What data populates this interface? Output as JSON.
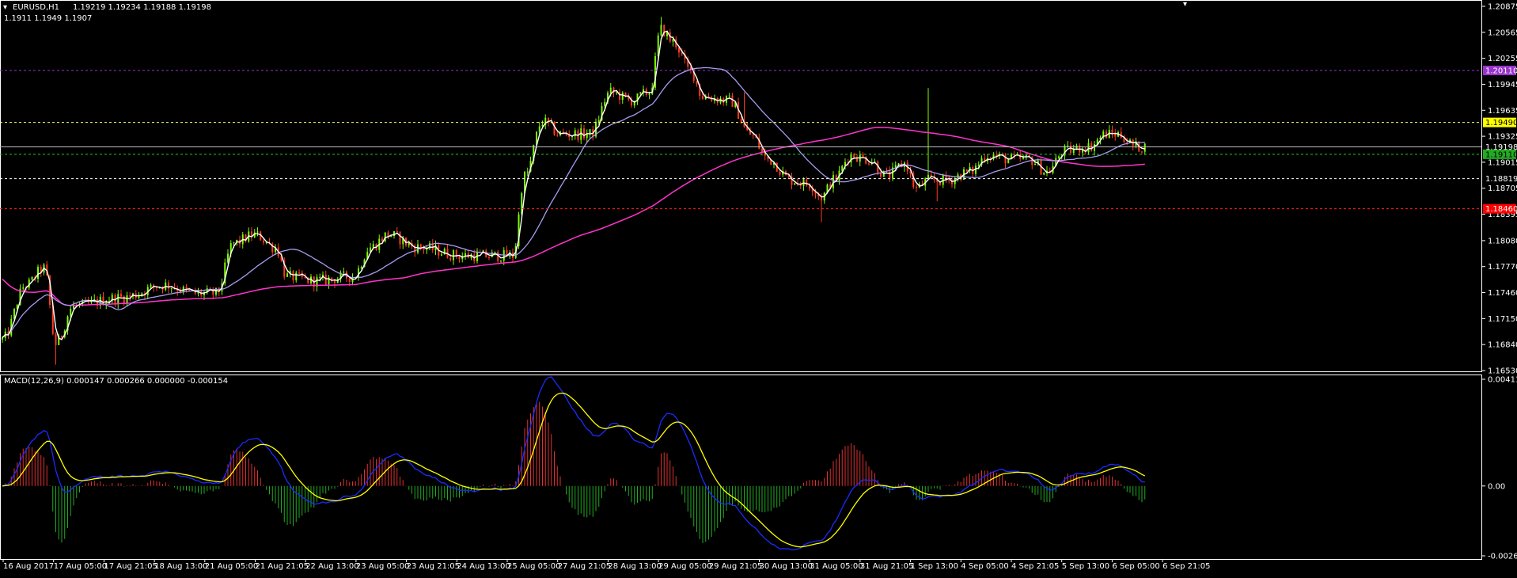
{
  "colors": {
    "background": "#000000",
    "frame": "#ffffff",
    "bull": "#7cfc00",
    "bear": "#ff3b1f",
    "fast_ma": "#ffffff",
    "mid_ma": "#a89cf0",
    "slow_ma": "#ff33cc",
    "macd_line": "#1a2cff",
    "signal_line": "#ffff00",
    "hist_pos": "#e03030",
    "hist_neg": "#22aa22"
  },
  "main_header": {
    "symbol": "EURUSD,H1",
    "ohlc": "1.19219 1.19234 1.19188 1.19198",
    "indicator_values": "1.1911 1.1949 1.1907"
  },
  "macd_header": "MACD(12,26,9) 0.000147 0.000266 0.000000 -0.000154",
  "chart_data": [
    {
      "type": "candlestick",
      "y_ticks": [
        "1.20875",
        "1.20565",
        "1.20255",
        "1.19945",
        "1.19635",
        "1.19325",
        "1.19015",
        "1.18705",
        "1.18395",
        "1.18080",
        "1.17770",
        "1.17460",
        "1.17150",
        "1.16840",
        "1.16530"
      ],
      "ylim": [
        1.1653,
        1.20875
      ],
      "x_ticks": [
        "16 Aug 2017",
        "17 Aug 05:00",
        "17 Aug 21:05",
        "18 Aug 13:00",
        "21 Aug 05:00",
        "21 Aug 21:05",
        "22 Aug 13:00",
        "23 Aug 05:00",
        "23 Aug 21:05",
        "24 Aug 13:00",
        "25 Aug 05:00",
        "27 Aug 21:05",
        "28 Aug 13:00",
        "29 Aug 05:00",
        "29 Aug 21:05",
        "30 Aug 13:00",
        "31 Aug 05:00",
        "31 Aug 21:05",
        "1 Sep 13:00",
        "4 Sep 05:00",
        "4 Sep 21:05",
        "5 Sep 13:00",
        "6 Sep 05:00",
        "6 Sep 21:05"
      ],
      "price_anchors": [
        [
          0,
          1.169
        ],
        [
          8,
          1.1755
        ],
        [
          14,
          1.1775
        ],
        [
          18,
          1.1685
        ],
        [
          24,
          1.173
        ],
        [
          40,
          1.174
        ],
        [
          55,
          1.1755
        ],
        [
          65,
          1.1745
        ],
        [
          72,
          1.1745
        ],
        [
          78,
          1.1805
        ],
        [
          85,
          1.1815
        ],
        [
          92,
          1.18
        ],
        [
          96,
          1.1765
        ],
        [
          105,
          1.176
        ],
        [
          118,
          1.1765
        ],
        [
          124,
          1.18
        ],
        [
          130,
          1.1815
        ],
        [
          140,
          1.18
        ],
        [
          155,
          1.179
        ],
        [
          168,
          1.179
        ],
        [
          172,
          1.179
        ],
        [
          176,
          1.1885
        ],
        [
          182,
          1.195
        ],
        [
          188,
          1.1935
        ],
        [
          198,
          1.1935
        ],
        [
          205,
          1.1985
        ],
        [
          212,
          1.1975
        ],
        [
          218,
          1.1985
        ],
        [
          222,
          1.206
        ],
        [
          226,
          1.2045
        ],
        [
          232,
          1.201
        ],
        [
          236,
          1.198
        ],
        [
          245,
          1.1975
        ],
        [
          252,
          1.1935
        ],
        [
          258,
          1.1905
        ],
        [
          266,
          1.188
        ],
        [
          272,
          1.1875
        ],
        [
          276,
          1.186
        ],
        [
          280,
          1.188
        ],
        [
          286,
          1.191
        ],
        [
          292,
          1.1905
        ],
        [
          298,
          1.1885
        ],
        [
          304,
          1.19
        ],
        [
          308,
          1.187
        ],
        [
          312,
          1.188
        ],
        [
          318,
          1.188
        ],
        [
          326,
          1.189
        ],
        [
          332,
          1.191
        ],
        [
          340,
          1.1905
        ],
        [
          346,
          1.1905
        ],
        [
          352,
          1.189
        ],
        [
          358,
          1.1915
        ],
        [
          366,
          1.192
        ],
        [
          372,
          1.1935
        ],
        [
          376,
          1.1935
        ],
        [
          382,
          1.192
        ],
        [
          385,
          1.192
        ]
      ],
      "hlines": [
        {
          "price": 1.2011,
          "label": "1.20110",
          "color": "#9933cc",
          "box_bg": "#9933cc",
          "box_fg": "#ffffff"
        },
        {
          "price": 1.1949,
          "label": "1.19490",
          "color": "#ffff66",
          "box_bg": "#ffff00",
          "box_fg": "#000000"
        },
        {
          "price": 1.19198,
          "label": "1.19198",
          "color": "#bfbfbf",
          "box_bg": "#000000",
          "box_fg": "#ffffff",
          "solid": true
        },
        {
          "price": 1.1911,
          "label": "1.19110",
          "color": "#22cc22",
          "box_bg": "#22aa22",
          "box_fg": "#000000"
        },
        {
          "price": 1.18819,
          "label": "1.18819",
          "color": "#ffffff",
          "box_bg": "#000000",
          "box_fg": "#ffffff"
        },
        {
          "price": 1.1846,
          "label": "1.18460",
          "color": "#ff2020",
          "box_bg": "#ff0000",
          "box_fg": "#ffffff"
        }
      ],
      "series": [
        {
          "type": "candles",
          "count": 386
        },
        {
          "type": "ma",
          "period": 3
        },
        {
          "type": "ma",
          "period": 24
        },
        {
          "type": "ma",
          "period": 120
        }
      ]
    },
    {
      "type": "macd",
      "y_ticks": [
        "0.00411",
        "0.00",
        "-0.00269"
      ],
      "ylim": [
        -0.00269,
        0.00411
      ]
    }
  ]
}
